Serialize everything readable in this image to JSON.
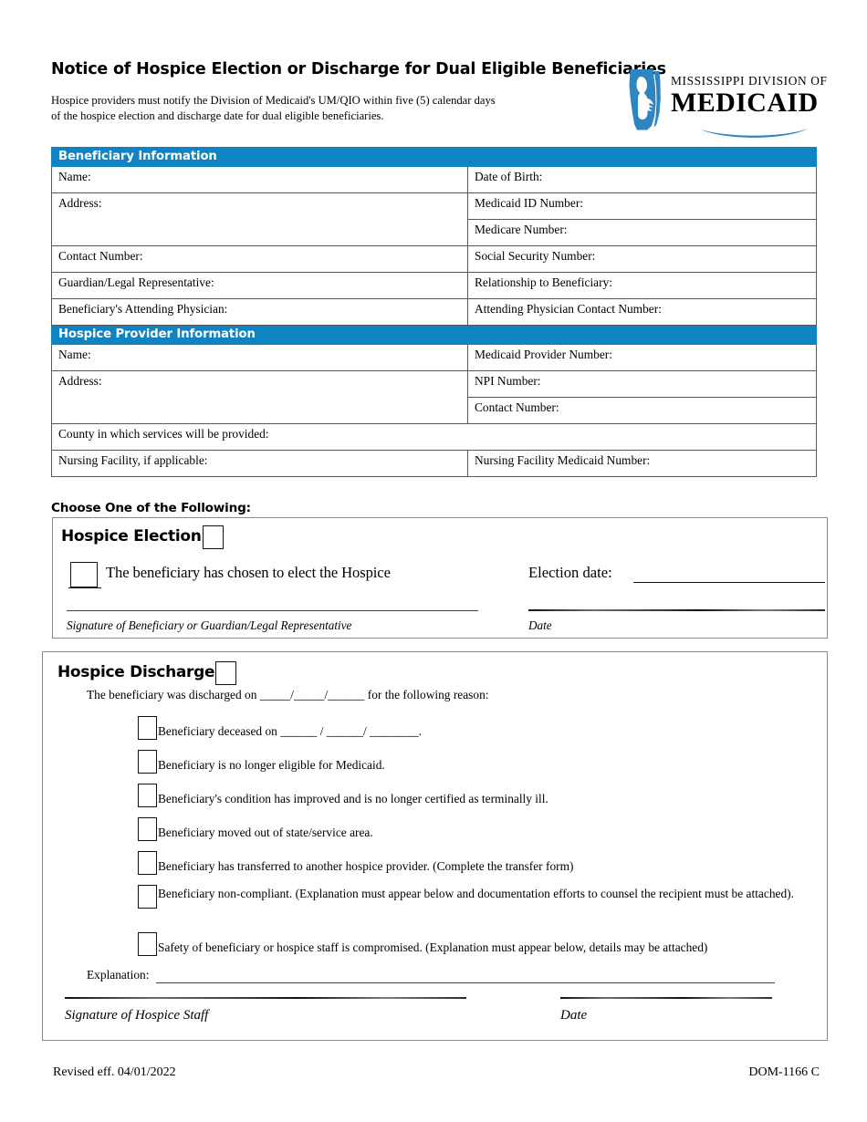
{
  "header": {
    "title": "Notice of Hospice Election or Discharge for Dual Eligible Beneficiaries",
    "subtitle_line1": "Hospice providers must notify the Division of Medicaid's UM/QIO within five (5) calendar days",
    "subtitle_line2": "of the hospice election and discharge date  for dual eligible beneficiaries."
  },
  "logo": {
    "line1": "MISSISSIPPI DIVISION OF",
    "line2": "MEDICAID",
    "mark_name": "mississippi-state-hands-icon",
    "brand_color": "#2E86C1"
  },
  "colors": {
    "section_header_blue": "#1083C2",
    "table_border": "#595959",
    "panel_border": "#8a8a8a"
  },
  "beneficiary_section": {
    "header": "Beneficiary Information",
    "rows": [
      {
        "left": "Name:",
        "right": "Date of Birth:"
      },
      {
        "left": "Address:",
        "right": "Medicaid ID Number:"
      },
      {
        "left": "",
        "right": "Medicare Number:"
      },
      {
        "left": "Contact Number:",
        "right": "Social Security Number:"
      },
      {
        "left": "Guardian/Legal Representative:",
        "right": "Relationship to Beneficiary:"
      },
      {
        "left": "Beneficiary's Attending Physician:",
        "right": "Attending Physician Contact Number:"
      }
    ]
  },
  "provider_section": {
    "header": "Hospice Provider Information",
    "rows": [
      {
        "left": "Name:",
        "right": "Medicaid Provider Number:"
      },
      {
        "left": "Address:",
        "right": "NPI Number:"
      },
      {
        "left": "",
        "right": "Contact Number:"
      }
    ],
    "county_row": "County in which services will be provided:",
    "nursing_left": "Nursing Facility, if applicable:",
    "nursing_right": "Nursing Facility Medicaid Number:"
  },
  "choose_label": "Choose One of the Following:",
  "election": {
    "title": "Hospice Election",
    "statement": "The beneficiary has chosen to elect the Hospice",
    "election_date_label": "Election date:",
    "signature_caption": "Signature of Beneficiary or Guardian/Legal Representative",
    "date_caption": "Date"
  },
  "discharge": {
    "title": "Hospice Discharge",
    "intro_before": "The beneficiary was discharged on",
    "intro_blank1": "_____",
    "intro_sep1": "/",
    "intro_blank2": "_____",
    "intro_sep2": "/",
    "intro_blank3": "______",
    "intro_after": "for the following reason:",
    "reasons": [
      "Beneficiary deceased on ______ / ______/ ________.",
      "Beneficiary is no longer eligible for Medicaid.",
      "Beneficiary's condition has improved and is no longer certified as terminally ill.",
      "Beneficiary moved out of state/service area.",
      "Beneficiary has transferred to another hospice provider. (Complete the transfer form)",
      "Beneficiary non-compliant. (Explanation must appear below and documentation efforts to counsel the recipient must be attached).",
      "Safety of beneficiary or hospice staff is compromised. (Explanation must appear below, details may be attached)"
    ],
    "explanation_label": "Explanation:",
    "signature_caption": "Signature of Hospice Staff",
    "date_caption": "Date"
  },
  "footer": {
    "revised": "Revised eff. 04/01/2022",
    "form_number": "DOM-1166 C"
  }
}
